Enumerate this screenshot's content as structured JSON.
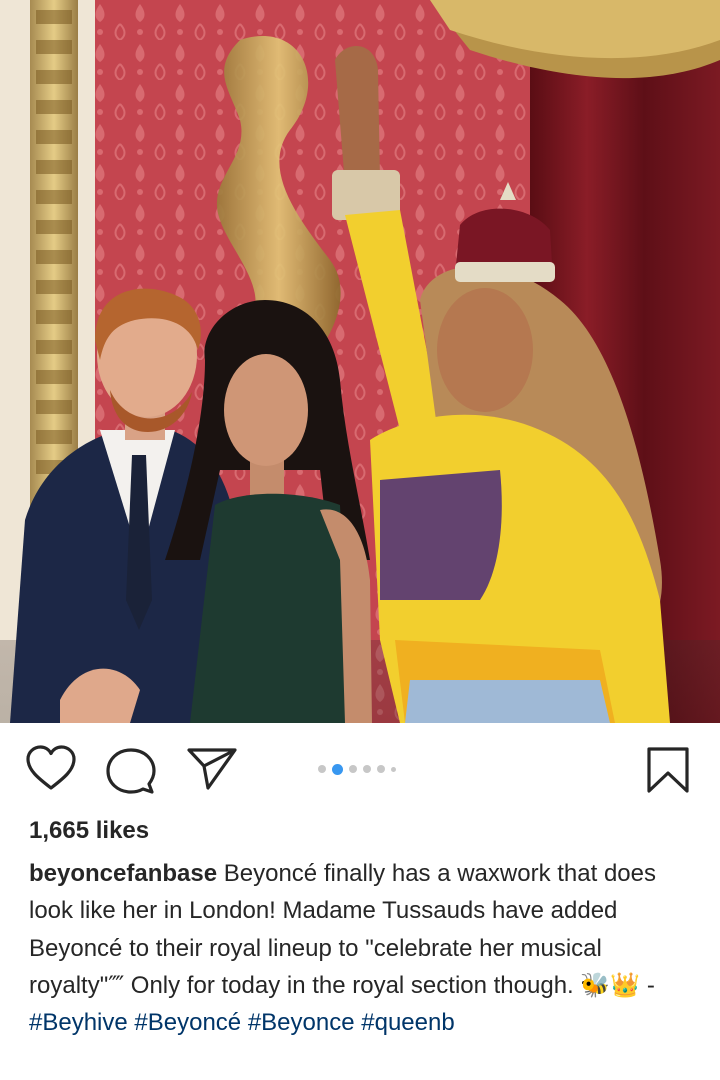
{
  "post": {
    "image": {
      "description_icon": "photo"
    },
    "actions": {
      "like_icon": "heart-outline",
      "comment_icon": "speech-bubble",
      "share_icon": "paper-plane",
      "save_icon": "bookmark-outline"
    },
    "carousel": {
      "total": 6,
      "active_index": 1
    },
    "likes_text": "1,665 likes",
    "caption": {
      "username": "beyoncefanbase",
      "text": "Beyoncé finally has a waxwork that does look like her in London! Madame Tussauds have added Beyoncé to their royal lineup to \"celebrate her musical royalty\"⁗ Only for today in the royal section though.",
      "emojis": "🐝👑",
      "separator": "-",
      "hashtags": [
        "#Beyhive",
        "#Beyoncé",
        "#Beyonce",
        "#queenb"
      ]
    },
    "colors": {
      "hashtag": "#003569",
      "active_dot": "#3897f0",
      "inactive_dot": "#c7c7c7",
      "text": "#262626"
    }
  }
}
